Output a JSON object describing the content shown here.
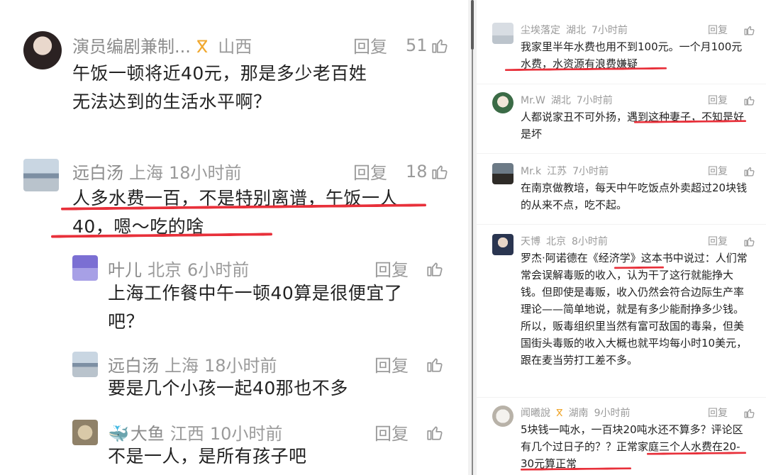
{
  "left": {
    "comments": [
      {
        "name": "演员编剧兼制...",
        "badge": "ಬ",
        "location": "山西",
        "time": "",
        "reply": "回复",
        "likes": "51",
        "text": "午饭一顿将近40元，那是多少老百姓无法达到的生活水平啊？"
      },
      {
        "name": "远白汤",
        "location": "上海",
        "time": "18小时前",
        "reply": "回复",
        "likes": "18",
        "text": "人多水费一百，不是特别离谱，午饭一人40，嗯～吃的啥"
      },
      {
        "name": "叶儿",
        "location": "北京",
        "time": "6小时前",
        "reply": "回复",
        "likes": "",
        "text": "上海工作餐中午一顿40算是很便宜了吧？"
      },
      {
        "name": "远白汤",
        "location": "上海",
        "time": "18小时前",
        "reply": "回复",
        "likes": "",
        "text": "要是几个小孩一起40那也不多"
      },
      {
        "name": "大鱼",
        "location": "江西",
        "time": "10小时前",
        "reply": "回复",
        "likes": "",
        "text": "不是一人，是所有孩子吧"
      }
    ]
  },
  "right": {
    "comments": [
      {
        "name": "尘埃落定",
        "location": "湖北",
        "time": "7小时前",
        "reply": "回复",
        "text": "我家里半年水费也用不到100元。一个月100元水费，水资源有浪费嫌疑"
      },
      {
        "name": "Mr.W",
        "location": "湖北",
        "time": "7小时前",
        "reply": "回复",
        "text": "人都说家丑不可外扬，遇到这种妻子，不知是好是坏"
      },
      {
        "name": "Mr.k",
        "location": "江苏",
        "time": "7小时前",
        "reply": "回复",
        "text": "在南京做教培，每天中午吃饭点外卖超过20块钱的从来不点，吃不起。"
      },
      {
        "name": "天博",
        "location": "北京",
        "time": "8小时前",
        "reply": "回复",
        "text": "罗杰·阿诺德在《经济学》这本书中说过：人们常常会误解毒贩的收入，认为干了这行就能挣大钱。但即使是毒贩，收入仍然会符合边际生产率理论——简单地说，就是有多少能耐挣多少钱。所以，贩毒组织里当然有富可敌国的毒枭，但美国街头毒贩的收入大概也就平均每小时10美元，跟在麦当劳打工差不多。"
      },
      {
        "name": "闻曦說",
        "badge": "ಬ",
        "location": "湖南",
        "time": "9小时前",
        "reply": "回复",
        "text": "5块钱一吨水，一百块20吨水还不算多？评论区有几个过日子的？？正常家庭三个人水费在20-30元算正常"
      }
    ]
  },
  "colors": {
    "underline": "#e8303a",
    "meta": "#9a9a9a",
    "text": "#222222"
  }
}
